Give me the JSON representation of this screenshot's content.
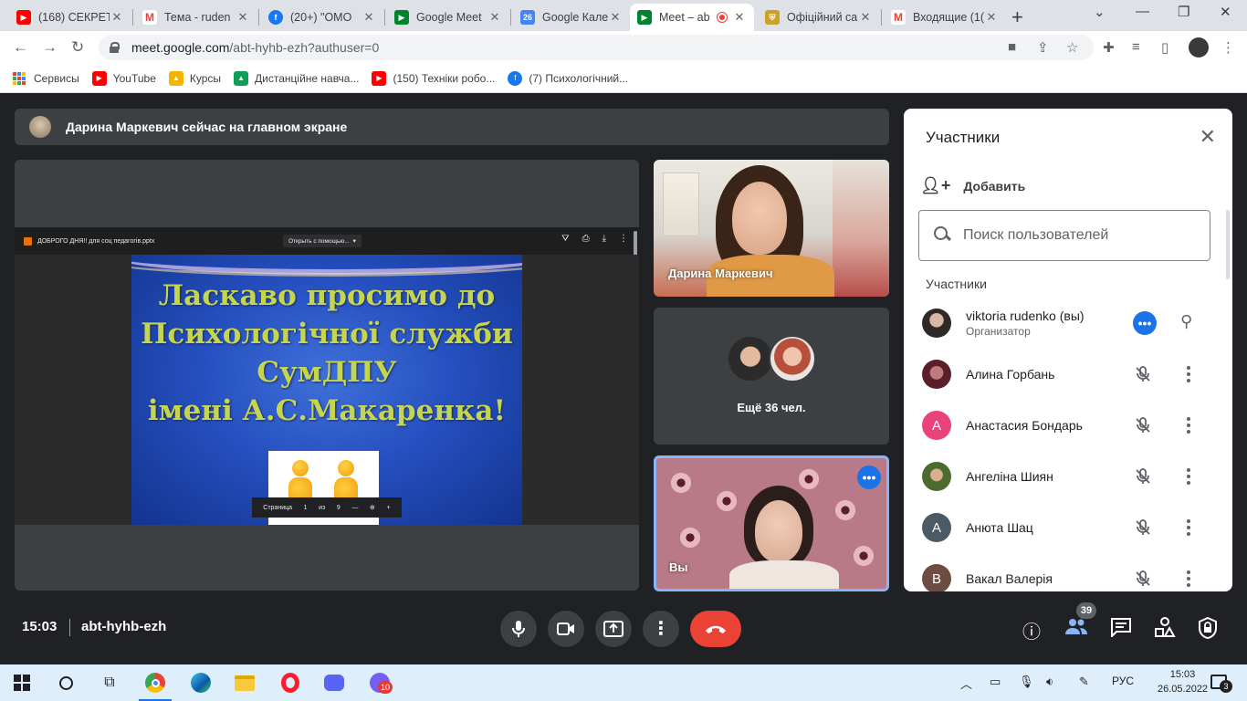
{
  "browser": {
    "tabs": [
      {
        "label": "(168) СЕКРЕТ",
        "icon": "youtube-icon",
        "color": "#ff0000"
      },
      {
        "label": "Тема - ruden",
        "icon": "gmail-icon",
        "color": "#ea4335"
      },
      {
        "label": "(20+) \"ОМО ",
        "icon": "facebook-icon",
        "color": "#1877f2"
      },
      {
        "label": "Google Meet",
        "icon": "meet-icon",
        "color": "#00832d"
      },
      {
        "label": "Google Кален",
        "icon": "calendar-icon",
        "color": "#4285f4"
      },
      {
        "label": "Meet – ab",
        "icon": "meet-icon",
        "color": "#00832d",
        "active": true
      },
      {
        "label": "Офіційний са",
        "icon": "university-icon",
        "color": "#c9a227"
      },
      {
        "label": "Входящие (1(",
        "icon": "gmail-icon",
        "color": "#ea4335"
      }
    ],
    "url_host": "meet.google.com",
    "url_path": "/abt-hyhb-ezh?authuser=0",
    "bookmarks": [
      {
        "label": "Сервисы",
        "icon": "apps-icon"
      },
      {
        "label": "YouTube",
        "icon": "youtube-icon",
        "color": "#ff0000"
      },
      {
        "label": "Курсы",
        "icon": "classroom-icon",
        "color": "#f4b400"
      },
      {
        "label": "Дистанційне навча...",
        "icon": "classroom-icon",
        "color": "#0f9d58"
      },
      {
        "label": "(150) Техніки робо...",
        "icon": "youtube-icon",
        "color": "#ff0000"
      },
      {
        "label": "(7) Психологічний...",
        "icon": "facebook-icon",
        "color": "#1877f2"
      }
    ]
  },
  "meet": {
    "notice": "Дарина Маркевич сейчас на главном экране",
    "presentation": {
      "file_name": "ДОБРОГО ДНЯ!! для соц педагогів.pptx",
      "open_with": "Открыть с помощью...",
      "slide_lines": [
        "Ласкаво просимо до",
        "Психологічної служби",
        "СумДПУ",
        "імені А.С.Макаренка!"
      ],
      "pager_label": "Страница",
      "page_current": "1",
      "page_of": "из",
      "page_total": "9"
    },
    "tiles": {
      "daryna_name": "Дарина Маркевич",
      "more_label": "Ещё 36 чел.",
      "you_name": "Вы"
    },
    "panel": {
      "title": "Участники",
      "add_label": "Добавить",
      "search_placeholder": "Поиск пользователей",
      "section": "Участники",
      "participants": [
        {
          "name": "viktoria rudenko (вы)",
          "role": "Организатор",
          "initial": "",
          "color": "#3a3a3a",
          "you": true
        },
        {
          "name": "Алина Горбань",
          "role": "",
          "initial": "",
          "color": "#7b2d3b"
        },
        {
          "name": "Анастасия Бондарь",
          "role": "",
          "initial": "А",
          "color": "#e8437a"
        },
        {
          "name": "Ангеліна Шиян",
          "role": "",
          "initial": "",
          "color": "#6b7d3a"
        },
        {
          "name": "Анюта Шац",
          "role": "",
          "initial": "А",
          "color": "#4a5a66"
        },
        {
          "name": "Вакал Валерія",
          "role": "",
          "initial": "В",
          "color": "#6d4c41"
        }
      ]
    },
    "bottom": {
      "time": "15:03",
      "meeting_code": "abt-hyhb-ezh",
      "participant_count": "39"
    }
  },
  "taskbar": {
    "lang": "РУС",
    "time": "15:03",
    "date": "26.05.2022",
    "viber_badge": "10",
    "notif_badge": "3"
  }
}
